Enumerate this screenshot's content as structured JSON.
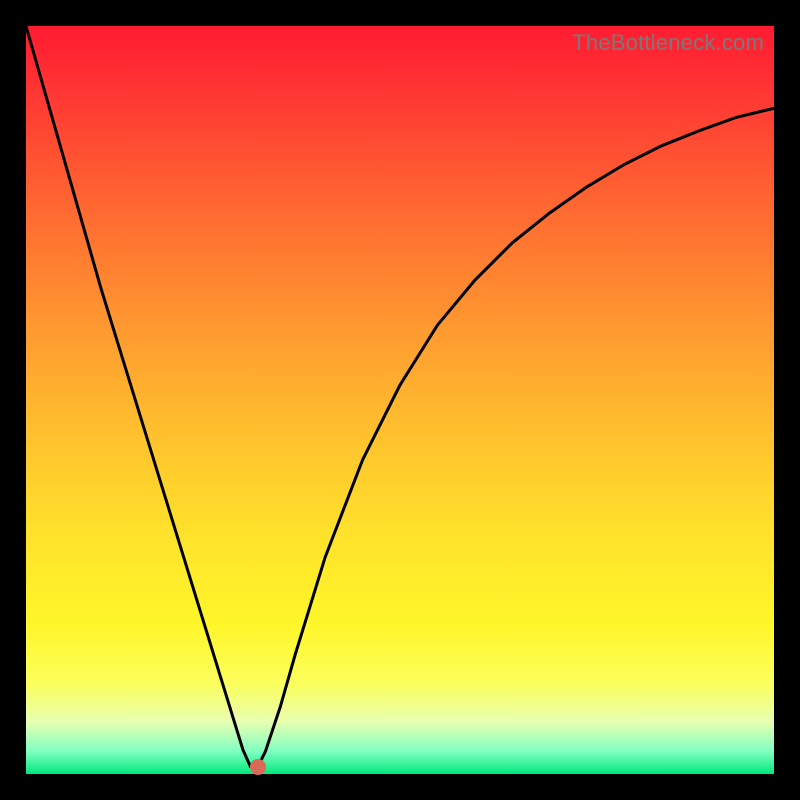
{
  "watermark": "TheBottleneck.com",
  "chart_data": {
    "type": "line",
    "title": "",
    "xlabel": "",
    "ylabel": "",
    "ylim": [
      0,
      100
    ],
    "x": [
      0,
      2,
      4,
      6,
      8,
      10,
      12,
      14,
      16,
      18,
      20,
      22,
      24,
      26,
      27,
      28,
      29,
      30,
      31,
      32,
      34,
      36,
      40,
      45,
      50,
      55,
      60,
      65,
      70,
      75,
      80,
      85,
      90,
      95,
      100
    ],
    "values": [
      100,
      93,
      86,
      79,
      72,
      65,
      58.5,
      52,
      45.5,
      39,
      32.5,
      26,
      19.5,
      13,
      9.75,
      6.5,
      3.25,
      1,
      1,
      3,
      9,
      16,
      29,
      42,
      52,
      60,
      66,
      71,
      75,
      78.5,
      81.5,
      84,
      86,
      87.8,
      89
    ],
    "marker": {
      "x": 31,
      "y": 1
    }
  },
  "colors": {
    "curve": "#000000",
    "marker": "#d86b57"
  }
}
